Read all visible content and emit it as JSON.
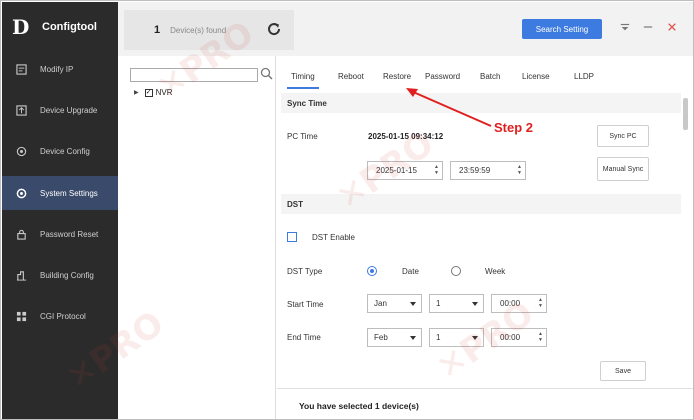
{
  "app": {
    "logo_mark": "D",
    "name": "Configtool"
  },
  "sidebar": {
    "items": [
      {
        "label": "Modify IP",
        "icon": "modify-ip-icon"
      },
      {
        "label": "Device Upgrade",
        "icon": "upgrade-icon"
      },
      {
        "label": "Device Config",
        "icon": "config-icon"
      },
      {
        "label": "System Settings",
        "icon": "settings-icon",
        "active": true
      },
      {
        "label": "Password Reset",
        "icon": "lock-icon"
      },
      {
        "label": "Building Config",
        "icon": "building-icon"
      },
      {
        "label": "CGI Protocol",
        "icon": "protocol-icon"
      }
    ]
  },
  "topbar": {
    "device_count": "1",
    "device_label": "Device(s) found",
    "search_setting": "Search Setting"
  },
  "tree": {
    "search_placeholder": "",
    "node_label": "NVR",
    "node_checked": true
  },
  "tabs": [
    "Timing",
    "Reboot",
    "Restore",
    "Password",
    "Batch",
    "License",
    "LLDP"
  ],
  "active_tab": "Timing",
  "sync_time": {
    "title": "Sync Time",
    "pc_time_label": "PC Time",
    "pc_time_value": "2025-01-15 09:34:12",
    "sync_pc_button": "Sync PC",
    "date_value": "2025-01-15",
    "time_value": "23:59:59",
    "manual_sync_button": "Manual Sync"
  },
  "dst": {
    "title": "DST",
    "enable_label": "DST Enable",
    "type_label": "DST Type",
    "type_date": "Date",
    "type_week": "Week",
    "start_label": "Start Time",
    "start_month": "Jan",
    "start_day": "1",
    "start_time": "00:00",
    "end_label": "End Time",
    "end_month": "Feb",
    "end_day": "1",
    "end_time": "00:00",
    "save_button": "Save"
  },
  "footer": {
    "selected_text": "You have selected 1 device(s)"
  },
  "annotation": {
    "step_label": "Step 2",
    "color": "#e02020"
  },
  "colors": {
    "sidebar_bg": "#2b2b2b",
    "active_nav": "#3a4a6b",
    "accent": "#3d7be0"
  }
}
